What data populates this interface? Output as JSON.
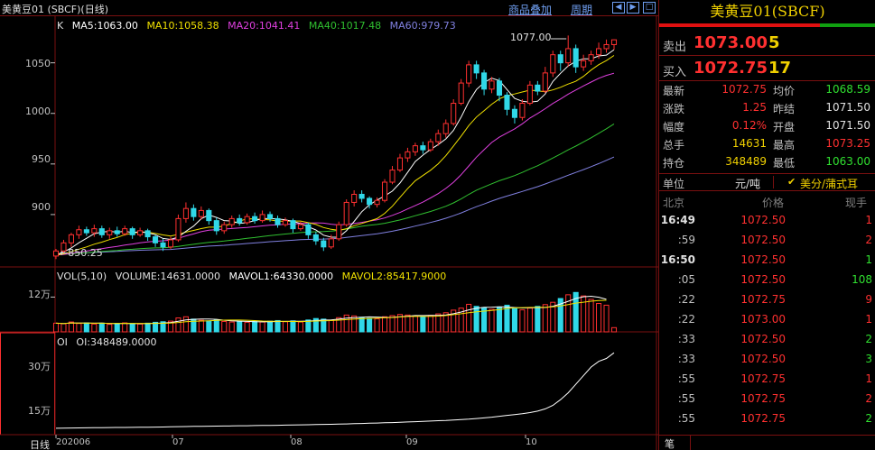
{
  "header": {
    "title": "美黄豆01 (SBCF)(日线)",
    "overlay_link": "商品叠加",
    "period_link": "周期",
    "btn_left": "◀",
    "btn_right": "▶",
    "btn_max": "□"
  },
  "legend": {
    "k": "K",
    "ma5": "MA5:1063.00",
    "ma10": "MA10:1058.38",
    "ma20": "MA20:1041.41",
    "ma40": "MA40:1017.48",
    "ma60": "MA60:979.73",
    "vol": "VOL(5,10)",
    "volume": "VOLUME:14631.0000",
    "mavol1": "MAVOL1:64330.0000",
    "mavol2": "MAVOL2:85417.9000",
    "oi": "OI",
    "oi_value": "OI:348489.0000"
  },
  "colors": {
    "up": "#ff3030",
    "down": "#30d8e8",
    "ma5": "#ffffff",
    "ma10": "#f0e000",
    "ma20": "#e040e0",
    "ma40": "#30c030",
    "ma60": "#8080e0",
    "grid": "#7a1010",
    "accent_yellow": "#f0d000",
    "green": "#30e030"
  },
  "axis": {
    "price_ticks": [
      "1050",
      "1000",
      "950",
      "900"
    ],
    "vol_tick": "12万",
    "oi_ticks": [
      "30万",
      "15万"
    ],
    "period_label": "日线",
    "dates": [
      "202006",
      "07",
      "08",
      "09",
      "10"
    ]
  },
  "markers": {
    "high": "1077.00",
    "low": "850.25"
  },
  "chart_data": {
    "type": "candlestick",
    "series_note": "",
    "price_range": [
      850,
      1080
    ],
    "candles": [
      [
        859,
        864,
        856,
        866
      ],
      [
        864,
        872,
        862,
        875
      ],
      [
        872,
        880,
        868,
        882
      ],
      [
        880,
        885,
        876,
        889
      ],
      [
        885,
        882,
        879,
        888
      ],
      [
        882,
        886,
        878,
        890
      ],
      [
        886,
        880,
        877,
        889
      ],
      [
        880,
        884,
        876,
        887
      ],
      [
        884,
        881,
        878,
        888
      ],
      [
        881,
        886,
        879,
        889
      ],
      [
        886,
        880,
        876,
        888
      ],
      [
        880,
        884,
        878,
        887
      ],
      [
        884,
        878,
        874,
        886
      ],
      [
        878,
        872,
        868,
        880
      ],
      [
        872,
        868,
        864,
        876
      ],
      [
        868,
        875,
        866,
        878
      ],
      [
        875,
        896,
        873,
        900
      ],
      [
        896,
        906,
        892,
        912
      ],
      [
        906,
        898,
        894,
        910
      ],
      [
        898,
        904,
        895,
        908
      ],
      [
        904,
        894,
        890,
        906
      ],
      [
        894,
        884,
        880,
        897
      ],
      [
        884,
        890,
        881,
        893
      ],
      [
        890,
        896,
        887,
        899
      ],
      [
        896,
        892,
        889,
        900
      ],
      [
        892,
        898,
        890,
        901
      ],
      [
        898,
        894,
        891,
        902
      ],
      [
        894,
        900,
        892,
        904
      ],
      [
        900,
        896,
        893,
        903
      ],
      [
        896,
        890,
        887,
        899
      ],
      [
        890,
        894,
        888,
        897
      ],
      [
        894,
        886,
        882,
        896
      ],
      [
        886,
        890,
        884,
        893
      ],
      [
        890,
        880,
        876,
        892
      ],
      [
        880,
        874,
        870,
        883
      ],
      [
        874,
        868,
        864,
        877
      ],
      [
        868,
        876,
        866,
        880
      ],
      [
        876,
        890,
        874,
        893
      ],
      [
        890,
        912,
        888,
        915
      ],
      [
        912,
        920,
        908,
        924
      ],
      [
        920,
        916,
        912,
        924
      ],
      [
        916,
        910,
        906,
        918
      ],
      [
        910,
        914,
        907,
        917
      ],
      [
        914,
        932,
        912,
        935
      ],
      [
        932,
        944,
        930,
        948
      ],
      [
        944,
        956,
        942,
        960
      ],
      [
        956,
        962,
        952,
        966
      ],
      [
        962,
        968,
        958,
        971
      ],
      [
        968,
        964,
        960,
        972
      ],
      [
        964,
        972,
        962,
        975
      ],
      [
        972,
        980,
        968,
        984
      ],
      [
        980,
        990,
        976,
        994
      ],
      [
        990,
        1010,
        988,
        1014
      ],
      [
        1010,
        1030,
        1008,
        1034
      ],
      [
        1030,
        1048,
        1026,
        1052
      ],
      [
        1048,
        1040,
        1034,
        1052
      ],
      [
        1040,
        1024,
        1018,
        1043
      ],
      [
        1024,
        1032,
        1020,
        1036
      ],
      [
        1032,
        1018,
        1012,
        1035
      ],
      [
        1018,
        1004,
        998,
        1021
      ],
      [
        1004,
        996,
        990,
        1008
      ],
      [
        996,
        1010,
        993,
        1014
      ],
      [
        1010,
        1028,
        1008,
        1032
      ],
      [
        1028,
        1022,
        1018,
        1032
      ],
      [
        1022,
        1040,
        1020,
        1046
      ],
      [
        1040,
        1058,
        1036,
        1062
      ],
      [
        1058,
        1050,
        1042,
        1062
      ],
      [
        1050,
        1064,
        1046,
        1077
      ],
      [
        1064,
        1046,
        1040,
        1068
      ],
      [
        1046,
        1052,
        1042,
        1058
      ],
      [
        1052,
        1058,
        1048,
        1062
      ],
      [
        1058,
        1064,
        1054,
        1070
      ],
      [
        1064,
        1068,
        1060,
        1073
      ],
      [
        1068,
        1072.75,
        1063,
        1073.25
      ]
    ],
    "volume": [
      30,
      28,
      34,
      29,
      31,
      27,
      30,
      26,
      29,
      31,
      28,
      27,
      30,
      33,
      35,
      37,
      48,
      52,
      44,
      40,
      38,
      42,
      36,
      34,
      35,
      33,
      36,
      34,
      37,
      39,
      35,
      38,
      34,
      41,
      46,
      44,
      40,
      49,
      58,
      55,
      50,
      47,
      45,
      52,
      56,
      60,
      58,
      55,
      53,
      57,
      62,
      66,
      75,
      82,
      95,
      88,
      84,
      78,
      86,
      92,
      80,
      76,
      82,
      88,
      94,
      102,
      115,
      128,
      136,
      124,
      112,
      98,
      92,
      14.6
    ],
    "oi": [
      18,
      18.2,
      18.5,
      18.6,
      18.8,
      19,
      19.1,
      19.3,
      19.5,
      19.4,
      19.6,
      19.8,
      20,
      20.1,
      20.3,
      20.5,
      20.8,
      21,
      21.3,
      21.5,
      21.6,
      21.8,
      22,
      22.2,
      22.4,
      22.5,
      22.8,
      23,
      23.1,
      23.3,
      23.5,
      23.8,
      24,
      24.2,
      24.5,
      24.8,
      25,
      25.3,
      25.6,
      26,
      26.4,
      26.8,
      27.2,
      27.6,
      28,
      28.5,
      29,
      29.5,
      30,
      30.6,
      31.2,
      31.8,
      32.5,
      33.2,
      34,
      35,
      36.2,
      37.5,
      39,
      40.5,
      42,
      43.5,
      45.5,
      48,
      52,
      58,
      68,
      80,
      95,
      110,
      125,
      135,
      140,
      150
    ]
  },
  "panel": {
    "title": "美黄豆01(SBCF)",
    "ask_label": "卖出",
    "ask_price": "1073.00",
    "ask_qty": "5",
    "bid_label": "买入",
    "bid_price": "1072.75",
    "bid_qty": "17",
    "stats": [
      {
        "label": "最新",
        "value": "1072.75",
        "color": "#ff3030",
        "label2": "均价",
        "value2": "1068.59",
        "color2": "#30e030"
      },
      {
        "label": "涨跌",
        "value": "1.25",
        "color": "#ff3030",
        "label2": "昨结",
        "value2": "1071.50",
        "color2": "#e0e0e0"
      },
      {
        "label": "幅度",
        "value": "0.12%",
        "color": "#ff3030",
        "label2": "开盘",
        "value2": "1071.50",
        "color2": "#e0e0e0"
      },
      {
        "label": "总手",
        "value": "14631",
        "color": "#f0d000",
        "label2": "最高",
        "value2": "1073.25",
        "color2": "#ff3030"
      },
      {
        "label": "持仓",
        "value": "348489",
        "color": "#f0d000",
        "label2": "最低",
        "value2": "1063.00",
        "color2": "#30e030"
      }
    ],
    "unit_label": "单位",
    "unit_value": "元/吨",
    "unit_check": "✔",
    "currency": "美分/蒲式耳",
    "tick_head": {
      "time": "北京",
      "price": "价格",
      "vol": "现手"
    },
    "ticks": [
      {
        "time": "16:49",
        "full": true,
        "price": "1072.50",
        "vol": "1",
        "vcolor": "#ff3030"
      },
      {
        "time": ":59",
        "full": false,
        "price": "1072.50",
        "vol": "2",
        "vcolor": "#ff3030"
      },
      {
        "time": "16:50",
        "full": true,
        "price": "1072.50",
        "vol": "1",
        "vcolor": "#30e030"
      },
      {
        "time": ":05",
        "full": false,
        "price": "1072.50",
        "vol": "108",
        "vcolor": "#30e030"
      },
      {
        "time": ":22",
        "full": false,
        "price": "1072.75",
        "vol": "9",
        "vcolor": "#ff3030"
      },
      {
        "time": ":22",
        "full": false,
        "price": "1073.00",
        "vol": "1",
        "vcolor": "#ff3030"
      },
      {
        "time": ":33",
        "full": false,
        "price": "1072.50",
        "vol": "2",
        "vcolor": "#30e030"
      },
      {
        "time": ":33",
        "full": false,
        "price": "1072.50",
        "vol": "3",
        "vcolor": "#30e030"
      },
      {
        "time": ":55",
        "full": false,
        "price": "1072.75",
        "vol": "1",
        "vcolor": "#ff3030"
      },
      {
        "time": ":55",
        "full": false,
        "price": "1072.75",
        "vol": "2",
        "vcolor": "#ff3030"
      },
      {
        "time": ":55",
        "full": false,
        "price": "1072.75",
        "vol": "2",
        "vcolor": "#30e030"
      }
    ],
    "foot_tab": "笔"
  }
}
